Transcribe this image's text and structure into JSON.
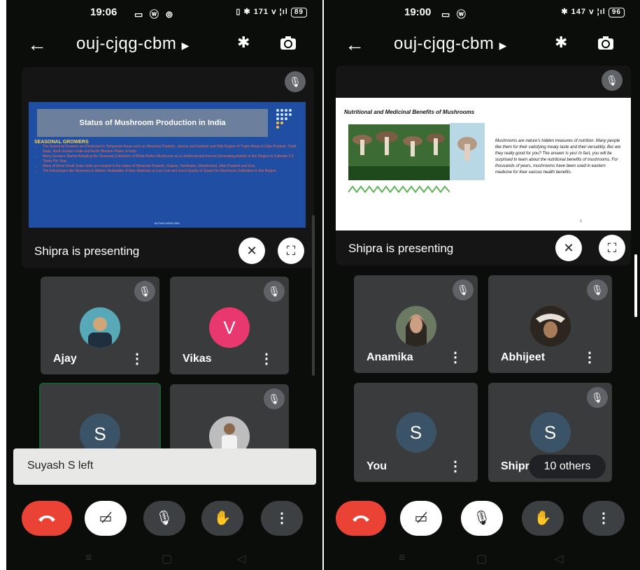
{
  "left": {
    "status": {
      "time": "19:06",
      "left_icons": "▭ ⓦ ⊚",
      "right_icons": "▯ ✱ 171 ⅴ ¦ıl",
      "battery": "89"
    },
    "meeting_code": "ouj-cjqg-cbm",
    "presentation": {
      "caption": "Shipra is presenting",
      "slide": {
        "title": "Status of Mushroom Production in India",
        "heading": "SEASONAL GROWERS",
        "bullets": [
          "The Seasonal Growers are Restricted to Temperate Areas such as Himachal Pradesh, Jammu and Kashmir and Hilly Region of Tropic Areas in Uttar Pradesh, Tamil Nadu, North Eastern India and North Western Plains of India",
          "Many Growers Started Adopting the Seasonal Cultivation of White Button Mushroom as a Livelihood and Income Generating Activity in this Region to Cultivate 2-3 Times Per Year.",
          "Many of these Small Scale Units are located in the states of Himachal Pradesh, Gujarat, Tamilnadu, Uttarakhand, Uttar Pradesh and Goa.",
          "The Advantages like Nearness to Market, Availability of Raw Materials at Low Cost and Good Quality of Spawn for Mushroom Cultivation in this Region"
        ],
        "footer": "BOTANYWEBCARE"
      }
    },
    "tiles": [
      {
        "name": "Ajay"
      },
      {
        "name": "Vikas",
        "initial": "V"
      },
      {
        "name": "",
        "initial": "S"
      },
      {
        "name": ""
      }
    ],
    "toast": "Suyash S left"
  },
  "right": {
    "status": {
      "time": "19:00",
      "left_icons": "▭ ⓦ",
      "right_icons": "✱ 147 ⅴ ¦ıl",
      "battery": "96"
    },
    "meeting_code": "ouj-cjqg-cbm",
    "presentation": {
      "caption": "Shipra is presenting",
      "slide": {
        "title": "Nutritional and Medicinal Benefits of Mushrooms",
        "body": "Mushrooms are nature's hidden treasures of nutrition. Many people like them for their satisfying meaty taste and their versatility. But are they really good for you? The answer is yes! In fact, you will be surprised to learn about the nutritional benefits of mushrooms. For thousands of years, mushrooms have been used in eastern medicine for their various health benefits.",
        "page": "1"
      }
    },
    "tiles": [
      {
        "name": "Anamika"
      },
      {
        "name": "Abhijeet"
      },
      {
        "name": "You",
        "initial": "S"
      },
      {
        "name": "Shipra",
        "initial": "S"
      }
    ],
    "others": "10 others"
  },
  "colors": {
    "end_call": "#ea4335",
    "tile_bg": "#3a3b3c",
    "vikas_avatar": "#e8386f",
    "initial_avatar": "#3b5367"
  }
}
